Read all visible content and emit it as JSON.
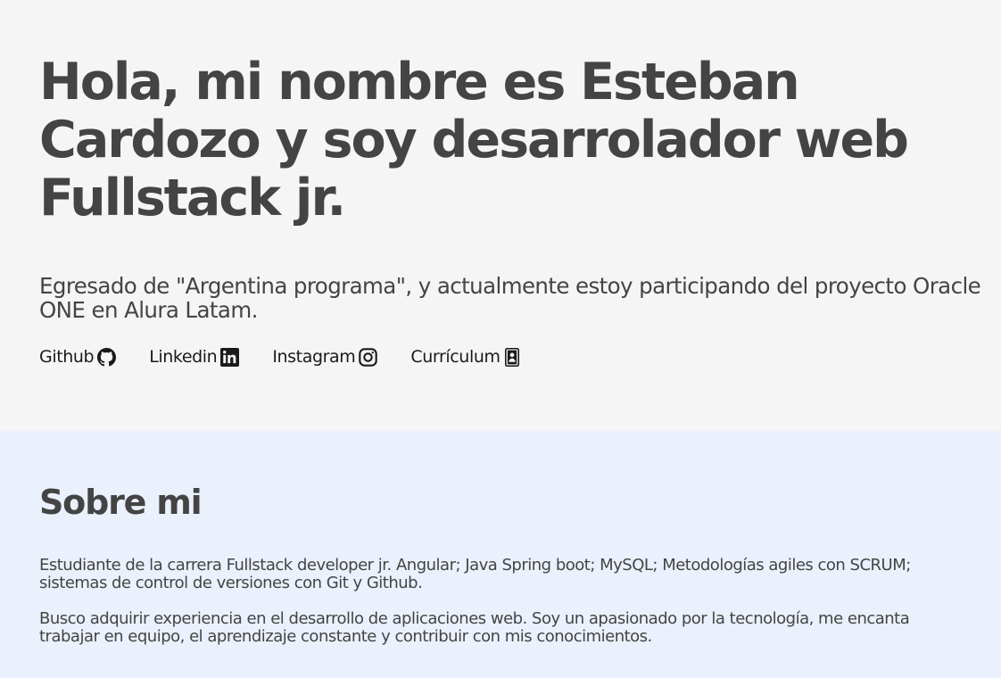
{
  "hero": {
    "title": "Hola, mi nombre es Esteban Cardozo y soy desarrolador web Fullstack jr.",
    "subtitle": "Egresado de \"Argentina programa\", y actualmente estoy participando del proyecto Oracle ONE en Alura Latam.",
    "links": [
      {
        "label": "Github",
        "icon": "github-icon"
      },
      {
        "label": "Linkedin",
        "icon": "linkedin-icon"
      },
      {
        "label": "Instagram",
        "icon": "instagram-icon"
      },
      {
        "label": "Currículum",
        "icon": "resume-icon"
      }
    ]
  },
  "about": {
    "heading": "Sobre mi",
    "paragraphs": [
      "Estudiante de la carrera Fullstack developer jr. Angular; Java Spring boot; MySQL; Metodologías agiles con SCRUM; sistemas de control de versiones con Git y Github.",
      "Busco adquirir experiencia en el desarrollo de aplicaciones web. Soy un apasionado por la tecnología, me encanta trabajar en equipo, el aprendizaje constante y contribuir con mis conocimientos."
    ]
  },
  "colors": {
    "hero_bg": "#f5f5f5",
    "about_bg": "#eaf1fc",
    "text": "#444444"
  }
}
